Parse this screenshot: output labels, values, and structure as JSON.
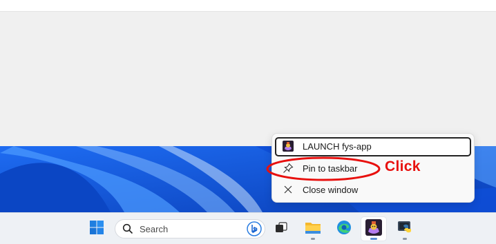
{
  "context_menu": {
    "items": [
      {
        "label": "LAUNCH fys-app",
        "icon": "app-icon"
      },
      {
        "label": "Pin to taskbar",
        "icon": "pin-icon"
      },
      {
        "label": "Close window",
        "icon": "close-icon"
      }
    ]
  },
  "annotation": {
    "text": "Click",
    "color": "#e8100e"
  },
  "taskbar": {
    "search_placeholder": "Search",
    "icons": [
      "windows-start-icon",
      "search-icon",
      "bing-icon",
      "task-view-icon",
      "file-explorer-icon",
      "edge-icon",
      "fys-app-icon",
      "python-icon"
    ]
  },
  "colors": {
    "accent": "#0a4fd0",
    "taskbar": "#eef1f5",
    "menu": "#f9f9f9"
  }
}
